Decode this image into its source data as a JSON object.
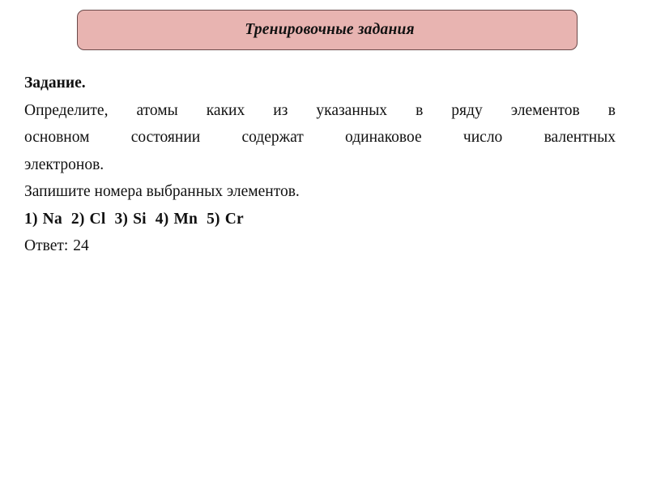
{
  "slide": {
    "background_color": "#ffffff",
    "header": {
      "title": "Тренировочные задания",
      "fill_color": "#e8b4b1",
      "border_color": "#6b4a4a"
    },
    "task": {
      "label": "Задание.",
      "prompt_line_1": "Определите, атомы каких из указанных в ряду элементов в",
      "prompt_line_2": "основном состоянии содержат одинаковое число валентных",
      "prompt_line_3": "электронов.",
      "instruction": "Запишите  номера выбранных элементов.",
      "options": [
        {
          "number": "1)",
          "symbol": "Na"
        },
        {
          "number": "2)",
          "symbol": "Cl"
        },
        {
          "number": "3)",
          "symbol": "Si"
        },
        {
          "number": "4)",
          "symbol": "Mn"
        },
        {
          "number": "5)",
          "symbol": "Cr"
        }
      ],
      "answer_label": "Ответ:",
      "answer_value": "24"
    }
  }
}
